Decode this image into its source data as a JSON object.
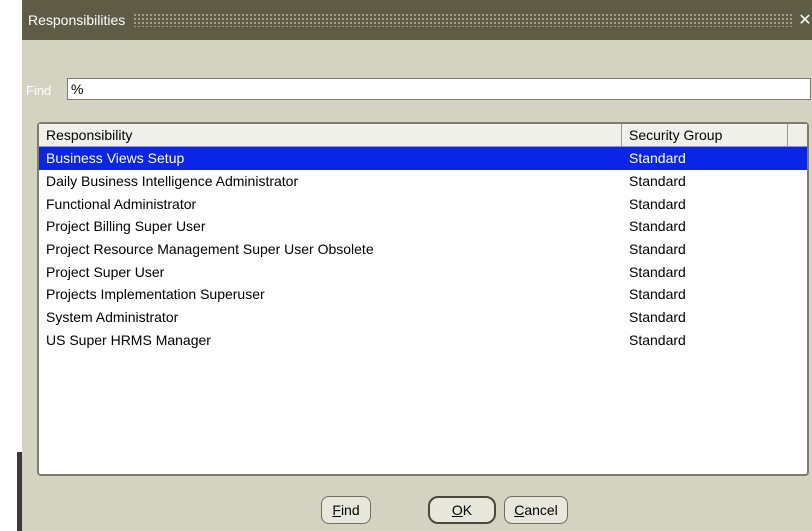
{
  "dialog": {
    "title": "Responsibilities",
    "close_icon": "close-icon"
  },
  "find": {
    "label": "Find",
    "value": "%"
  },
  "table": {
    "columns": [
      "Responsibility",
      "Security Group"
    ],
    "selected_index": 0,
    "rows": [
      {
        "responsibility": "Business Views Setup",
        "security_group": "Standard"
      },
      {
        "responsibility": "Daily Business Intelligence Administrator",
        "security_group": "Standard"
      },
      {
        "responsibility": "Functional Administrator",
        "security_group": "Standard"
      },
      {
        "responsibility": "Project Billing Super User",
        "security_group": "Standard"
      },
      {
        "responsibility": "Project Resource Management Super User Obsolete",
        "security_group": "Standard"
      },
      {
        "responsibility": "Project Super User",
        "security_group": "Standard"
      },
      {
        "responsibility": "Projects Implementation Superuser",
        "security_group": "Standard"
      },
      {
        "responsibility": "System Administrator",
        "security_group": "Standard"
      },
      {
        "responsibility": "US Super HRMS Manager",
        "security_group": "Standard"
      }
    ]
  },
  "buttons": {
    "find": {
      "mnemonic": "F",
      "rest": "ind"
    },
    "ok": {
      "mnemonic": "O",
      "rest": "K"
    },
    "cancel": {
      "mnemonic": "C",
      "rest": "ancel"
    }
  },
  "colors": {
    "titlebar": "#5e5b47",
    "dialog_bg": "#d4d3c2",
    "selection": "#0a24e8"
  }
}
